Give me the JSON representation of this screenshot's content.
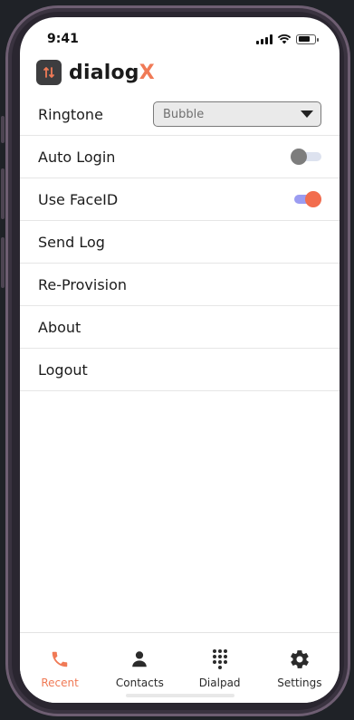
{
  "status_bar": {
    "time": "9:41"
  },
  "brand": {
    "name_main": "dialog",
    "name_accent": "X"
  },
  "settings": {
    "ringtone": {
      "label": "Ringtone",
      "value": "Bubble"
    },
    "auto_login": {
      "label": "Auto Login",
      "enabled": false
    },
    "use_faceid": {
      "label": "Use FaceID",
      "enabled": true
    },
    "send_log": {
      "label": "Send Log"
    },
    "re_provision": {
      "label": "Re-Provision"
    },
    "about": {
      "label": "About"
    },
    "logout": {
      "label": "Logout"
    }
  },
  "tabs": [
    {
      "label": "Recent",
      "icon": "phone-icon",
      "active": true
    },
    {
      "label": "Contacts",
      "icon": "person-icon",
      "active": false
    },
    {
      "label": "Dialpad",
      "icon": "dialpad-icon",
      "active": false
    },
    {
      "label": "Settings",
      "icon": "gear-icon",
      "active": false
    }
  ],
  "colors": {
    "accent": "#f07a56",
    "toggle_track_on": "#9b9cf1",
    "toggle_knob_on": "#f26d4e",
    "toggle_knob_off": "#7d7d7d"
  }
}
